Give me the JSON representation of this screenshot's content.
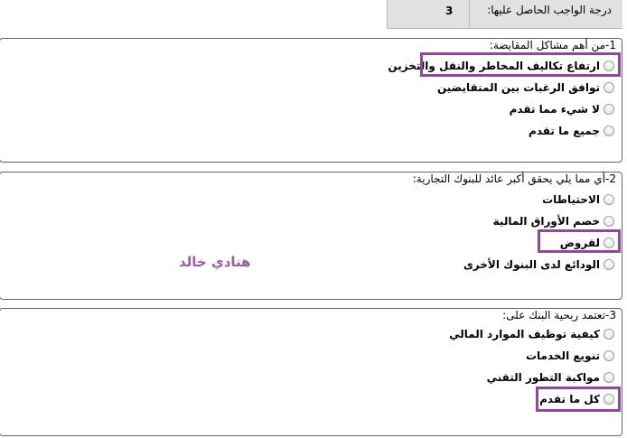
{
  "header": {
    "score_label": "درجة الواجب الحاصل عليها:",
    "score_value": "3"
  },
  "questions": [
    {
      "title": "1-من أهم مشاكل المقايضة:",
      "options": [
        {
          "label": "ارتفاع تكاليف المخاطر والنقل والتخزين",
          "highlighted": true
        },
        {
          "label": "توافق الرغبات بين المتقايضين",
          "highlighted": false
        },
        {
          "label": "لا شيء مما تقدم",
          "highlighted": false
        },
        {
          "label": "جميع ما تقدم",
          "highlighted": false
        }
      ]
    },
    {
      "title": "2-أي مما يلي يحقق أكبر عائد للبنوك التجارية:",
      "options": [
        {
          "label": "الاحتياطات",
          "highlighted": false
        },
        {
          "label": "خصم الأوراق المالية",
          "highlighted": false
        },
        {
          "label": "لقروض",
          "highlighted": true
        },
        {
          "label": "الودائع لدى البنوك الأخرى",
          "highlighted": false
        }
      ]
    },
    {
      "title": "3-تعتمد ربحية البنك على:",
      "options": [
        {
          "label": "كيفية توظيف الموارد المالي",
          "highlighted": false
        },
        {
          "label": "تنويع الخدمات",
          "highlighted": false
        },
        {
          "label": "مواكبة التطور التقني",
          "highlighted": false
        },
        {
          "label": "كل ما تقدم",
          "highlighted": true
        }
      ]
    }
  ],
  "watermark": "هنادي خالد",
  "colors": {
    "highlight": "#8e4a9a",
    "watermark": "#9a5ba7",
    "score_bg": "#e1e1e1"
  }
}
